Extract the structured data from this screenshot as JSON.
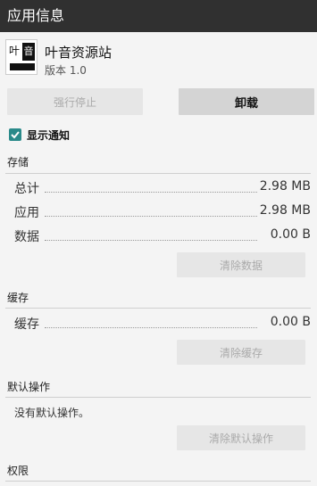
{
  "titlebar": {
    "title": "应用信息"
  },
  "app": {
    "name": "叶音资源站",
    "version": "版本 1.0",
    "icon_char1": "叶",
    "icon_char2": "音"
  },
  "buttons": {
    "force_stop": "强行停止",
    "uninstall": "卸载"
  },
  "notification": {
    "label": "显示通知",
    "checked": true
  },
  "storage": {
    "heading": "存储",
    "rows": [
      {
        "label": "总计",
        "value": "2.98 MB"
      },
      {
        "label": "应用",
        "value": "2.98 MB"
      },
      {
        "label": "数据",
        "value": "0.00 B"
      }
    ],
    "clear_button": "清除数据"
  },
  "cache": {
    "heading": "缓存",
    "rows": [
      {
        "label": "缓存",
        "value": "0.00 B"
      }
    ],
    "clear_button": "清除缓存"
  },
  "defaults": {
    "heading": "默认操作",
    "text": "没有默认操作。",
    "clear_button": "清除默认操作"
  },
  "permissions": {
    "heading": "权限"
  }
}
